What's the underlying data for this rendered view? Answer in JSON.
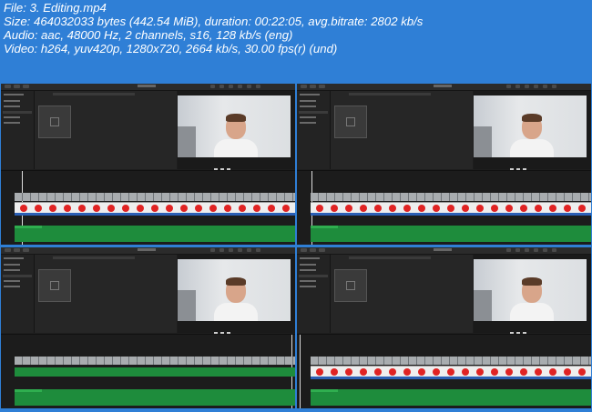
{
  "header": {
    "file": "File: 3. Editing.mp4",
    "size": "Size: 464032033 bytes (442.54 MiB), duration: 00:22:05, avg.bitrate: 2802 kb/s",
    "audio": "Audio: aac, 48000 Hz, 2 channels, s16, 128 kb/s (eng)",
    "video": "Video: h264, yuv420p, 1280x720, 2664 kb/s, 30.00 fps(r) (und)"
  },
  "colors": {
    "background": "#2f7fd6",
    "text": "#ffffff",
    "marker_red": "#e02323",
    "audio_green": "#1e8c3c"
  },
  "thumbnails": [
    {
      "name": "thumb-1",
      "playhead": 0.07,
      "style": "markers"
    },
    {
      "name": "thumb-2",
      "playhead": 0.05,
      "style": "markers"
    },
    {
      "name": "thumb-3",
      "playhead": 0.99,
      "style": "faces"
    },
    {
      "name": "thumb-4",
      "playhead": 0.01,
      "style": "markers"
    }
  ]
}
